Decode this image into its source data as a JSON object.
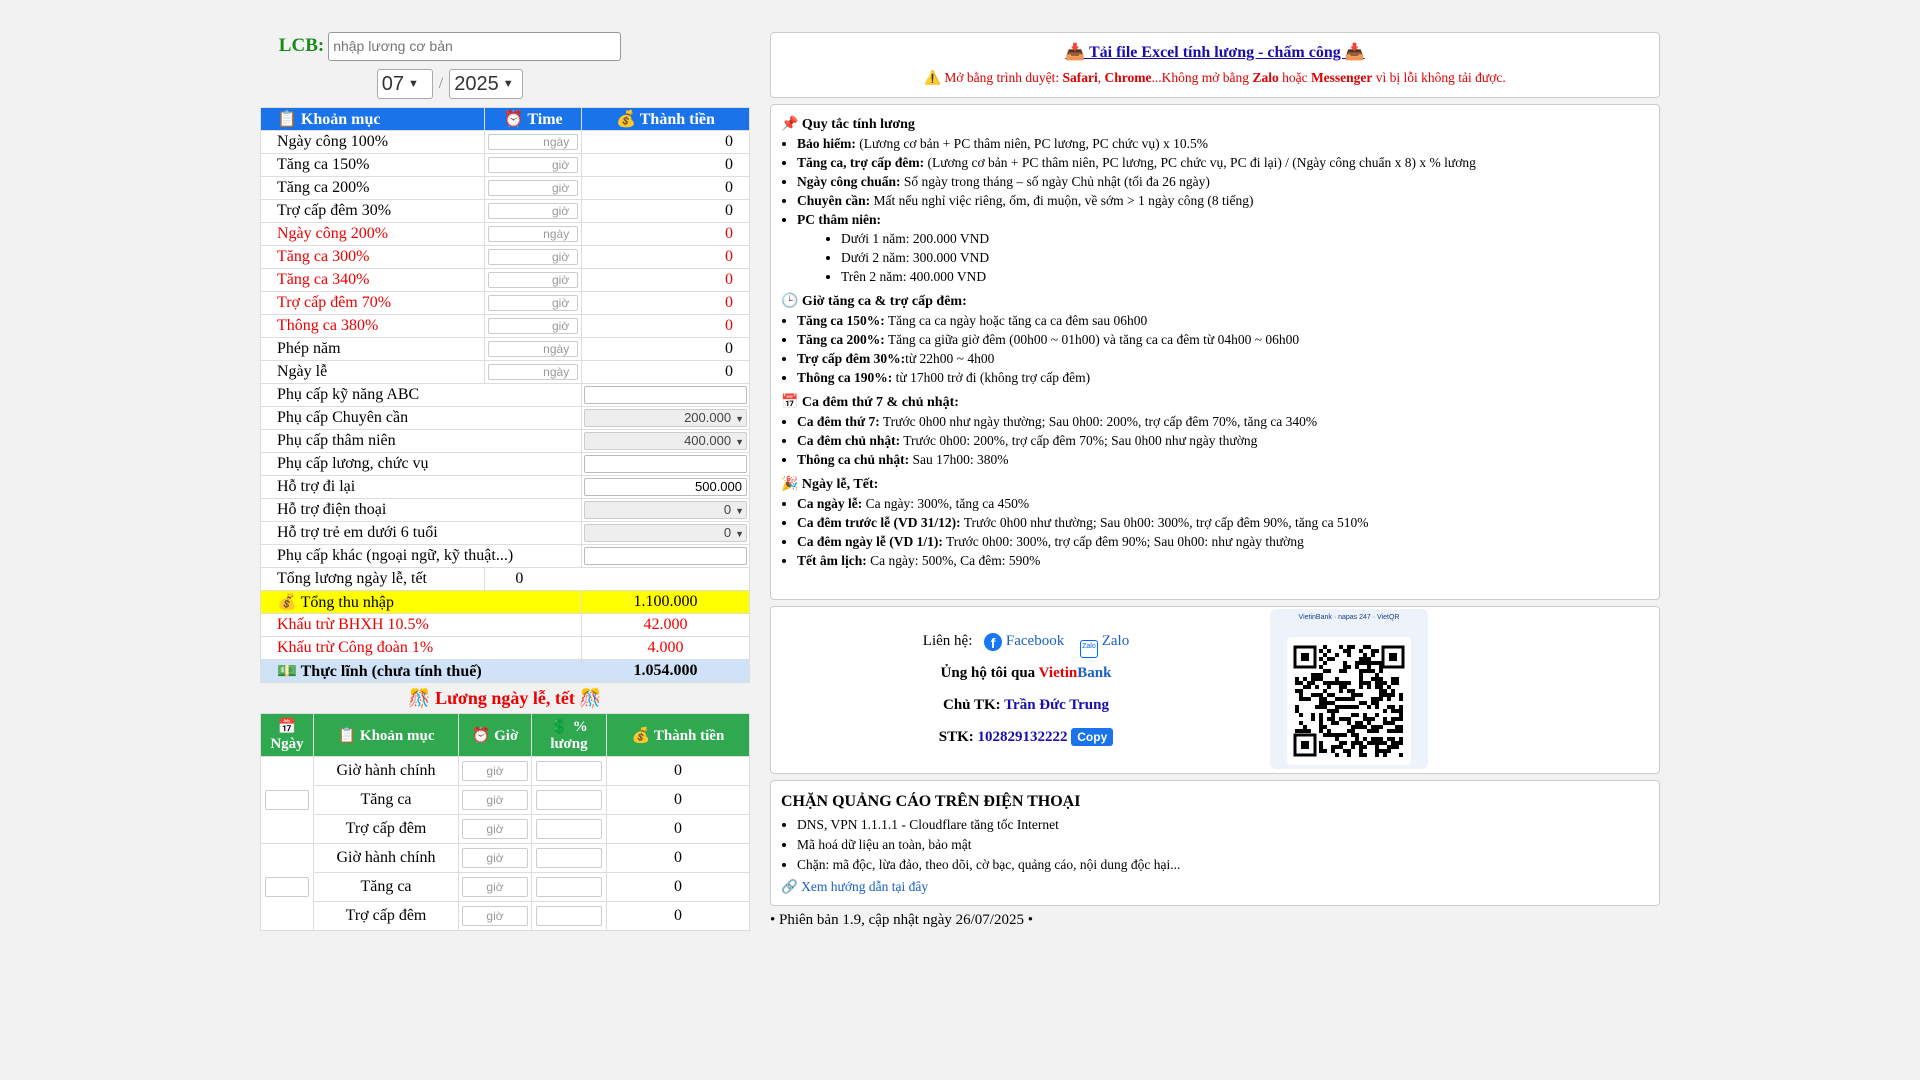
{
  "lcb": {
    "label": "LCB:",
    "placeholder": "nhập lương cơ bản"
  },
  "month": "07",
  "year": "2025",
  "separator": "/",
  "main_table": {
    "headers": [
      "📋 Khoản mục",
      "⏰ Time",
      "💰 Thành tiền"
    ],
    "rows": [
      {
        "label": "Ngày công 100%",
        "unit": "ngày",
        "value": "0"
      },
      {
        "label": "Tăng ca 150%",
        "unit": "giờ",
        "value": "0"
      },
      {
        "label": "Tăng ca 200%",
        "unit": "giờ",
        "value": "0"
      },
      {
        "label": "Trợ cấp đêm 30%",
        "unit": "giờ",
        "value": "0"
      },
      {
        "label": "Ngày công 200%",
        "unit": "ngày",
        "value": "0"
      },
      {
        "label": "Tăng ca 300%",
        "unit": "giờ",
        "value": "0"
      },
      {
        "label": "Tăng ca 340%",
        "unit": "giờ",
        "value": "0"
      },
      {
        "label": "Trợ cấp đêm 70%",
        "unit": "giờ",
        "value": "0"
      },
      {
        "label": "Thông ca 380%",
        "unit": "giờ",
        "value": "0"
      },
      {
        "label": "Phép năm",
        "unit": "ngày",
        "value": "0"
      },
      {
        "label": "Ngày lễ",
        "unit": "ngày",
        "value": "0"
      }
    ],
    "allowances": [
      {
        "label": "Phụ cấp kỹ năng ABC",
        "value": ""
      },
      {
        "label": "Phụ cấp Chuyên cần",
        "value": "200.000"
      },
      {
        "label": "Phụ cấp thâm niên",
        "value": "400.000"
      },
      {
        "label": "Phụ cấp lương, chức vụ",
        "value": ""
      },
      {
        "label": "Hỗ trợ đi lại",
        "value": "500.000"
      },
      {
        "label": "Hỗ trợ điện thoại",
        "value": "0"
      },
      {
        "label": "Hỗ trợ trẻ em dưới 6 tuổi",
        "value": "0"
      },
      {
        "label": "Phụ cấp khác (ngoại ngữ, kỹ thuật...)",
        "value": ""
      }
    ],
    "holiday_total": {
      "label": "Tổng lương ngày lễ, tết",
      "value": "0"
    },
    "total_income": {
      "label": "💰 Tổng thu nhập",
      "value": "1.100.000"
    },
    "bhxh": {
      "label": "Khấu trừ BHXH 10.5%",
      "value": "42.000"
    },
    "union": {
      "label": "Khấu trừ Công đoàn 1%",
      "value": "4.000"
    },
    "net": {
      "label": "💵 Thực lĩnh (chưa tính thuế)",
      "value": "1.054.000"
    }
  },
  "holiday": {
    "title": "🎊 Lương ngày lễ, tết 🎊",
    "headers": [
      "📅 Ngày",
      "📋 Khoản mục",
      "⏰ Giờ",
      "💲 % lương",
      "💰 Thành tiền"
    ],
    "items": [
      "Giờ hành chính",
      "Tăng ca",
      "Trợ cấp đêm",
      "Giờ hành chính",
      "Tăng ca",
      "Trợ cấp đêm"
    ],
    "unit": "giờ",
    "values": [
      "0",
      "0",
      "0",
      "0",
      "0",
      "0"
    ]
  },
  "download": {
    "title": "📥 Tải file Excel tính lương - chấm công 📥",
    "note_prefix": "⚠️ Mở bằng trình duyệt: ",
    "safari": "Safari",
    "comma": ", ",
    "chrome": "Chrome",
    "note_mid": "...Không mở bằng ",
    "zalo": "Zalo",
    "or": " hoặc ",
    "messenger": "Messenger",
    "note_end": " vì bị lỗi không tải được."
  },
  "rules": {
    "title": "📌 Quy tắc tính lương",
    "items": [
      {
        "b": "Bảo hiểm:",
        "t": " (Lương cơ bản + PC thâm niên, PC lương, PC chức vụ) x 10.5%"
      },
      {
        "b": "Tăng ca, trợ cấp đêm:",
        "t": " (Lương cơ bản + PC thâm niên, PC lương, PC chức vụ, PC đi lại) / (Ngày công chuẩn x 8) x % lương"
      },
      {
        "b": "Ngày công chuẩn:",
        "t": " Số ngày trong tháng – số ngày Chủ nhật (tối đa 26 ngày)"
      },
      {
        "b": "Chuyên cần:",
        "t": " Mất nếu nghỉ việc riêng, ốm, đi muộn, về sớm > 1 ngày công (8 tiếng)"
      },
      {
        "b": "PC thâm niên:",
        "t": ""
      }
    ],
    "seniority": [
      "Dưới 1 năm: 200.000 VND",
      "Dưới 2 năm: 300.000 VND",
      "Trên 2 năm: 400.000 VND"
    ],
    "ot_title": "🕒 Giờ tăng ca & trợ cấp đêm:",
    "ot_items": [
      {
        "b": "Tăng ca 150%:",
        "t": " Tăng ca ca ngày hoặc tăng ca ca đêm sau 06h00"
      },
      {
        "b": "Tăng ca 200%:",
        "t": " Tăng ca giữa giờ đêm (00h00 ~ 01h00) và tăng ca ca đêm từ 04h00 ~ 06h00"
      },
      {
        "b": "Trợ cấp đêm 30%:",
        "t": "từ 22h00 ~ 4h00"
      },
      {
        "b": "Thông ca 190%:",
        "t": " từ 17h00 trở đi (không trợ cấp đêm)"
      }
    ],
    "weekend_title": "📅 Ca đêm thứ 7 & chủ nhật:",
    "weekend_items": [
      {
        "b": "Ca đêm thứ 7:",
        "t": " Trước 0h00 như ngày thường; Sau 0h00: 200%, trợ cấp đêm 70%, tăng ca 340%"
      },
      {
        "b": "Ca đêm chủ nhật:",
        "t": " Trước 0h00: 200%, trợ cấp đêm 70%; Sau 0h00 như ngày thường"
      },
      {
        "b": "Thông ca chủ nhật:",
        "t": " Sau 17h00: 380%"
      }
    ],
    "holiday_title": "🎉 Ngày lễ, Tết:",
    "holiday_items": [
      {
        "b": "Ca ngày lễ:",
        "t": " Ca ngày: 300%, tăng ca 450%"
      },
      {
        "b": "Ca đêm trước lễ (VD 31/12):",
        "t": " Trước 0h00 như thường; Sau 0h00: 300%, trợ cấp đêm 90%, tăng ca 510%"
      },
      {
        "b": "Ca đêm ngày lễ (VD 1/1):",
        "t": " Trước 0h00: 300%, trợ cấp đêm 90%; Sau 0h00: như ngày thường"
      },
      {
        "b": "Tết âm lịch:",
        "t": " Ca ngày: 500%, Ca đêm: 590%"
      }
    ]
  },
  "contact": {
    "label": "Liên hệ:",
    "facebook": "Facebook",
    "zalo": "Zalo",
    "support_prefix": "Ủng hộ tôi qua ",
    "vietin": "Vietin",
    "bank": "Bank",
    "holder_label": "Chủ TK: ",
    "holder": "Trần Đức Trung",
    "stk_label": "STK: ",
    "stk": "102829132222",
    "copy": "Copy",
    "qr_brands": "VietinBank · napas 247 · VietQR"
  },
  "ads": {
    "title": "CHẶN QUẢNG CÁO TRÊN ĐIỆN THOẠI",
    "items": [
      "DNS, VPN 1.1.1.1 - Cloudflare tăng tốc Internet",
      "Mã hoá dữ liệu an toàn, bảo mật",
      "Chặn: mã độc, lừa đảo, theo dõi, cờ bạc, quảng cáo, nội dung độc hại..."
    ],
    "link": "🔗 Xem hướng dẫn tại đây"
  },
  "version": "• Phiên bản 1.9, cập nhật ngày 26/07/2025 •",
  "colors": {
    "header_blue": "#1a73e8",
    "header_green": "#2fa84f",
    "highlight_yellow": "#ffff00",
    "net_blue": "#cfe2f7",
    "red": "#e00000"
  }
}
